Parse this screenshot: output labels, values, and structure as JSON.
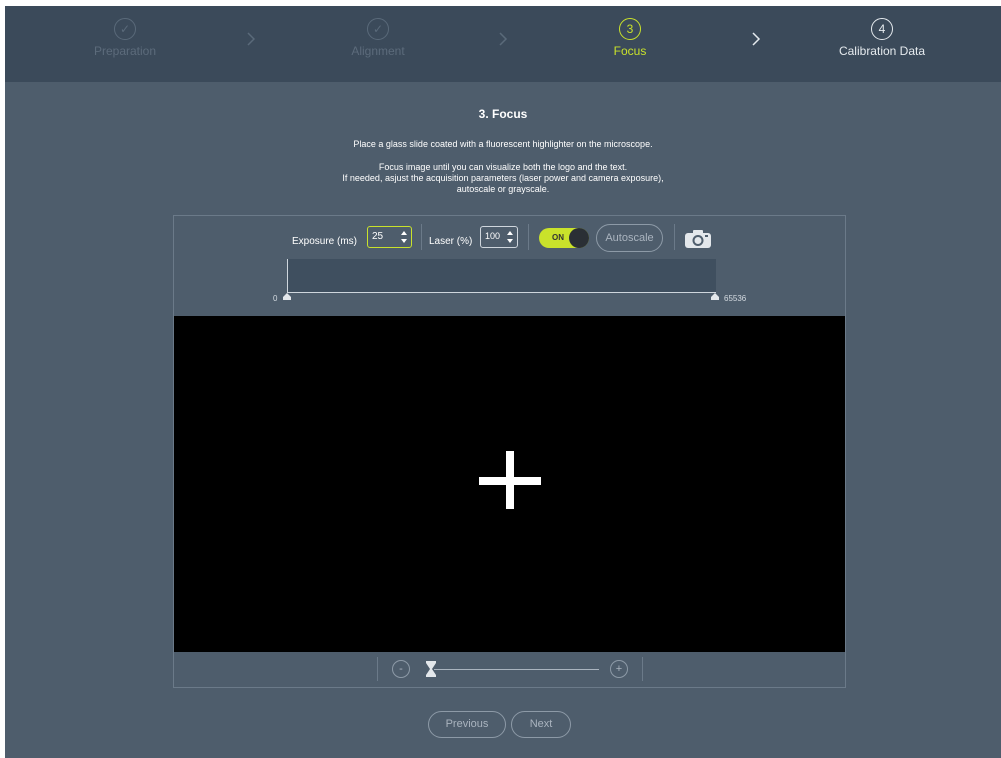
{
  "stepper": {
    "steps": [
      {
        "label": "Preparation",
        "marker": "✓",
        "state": "done"
      },
      {
        "label": "Alignment",
        "marker": "✓",
        "state": "done"
      },
      {
        "label": "Focus",
        "marker": "3",
        "state": "active"
      },
      {
        "label": "Calibration Data",
        "marker": "4",
        "state": "future"
      }
    ]
  },
  "content": {
    "title": "3. Focus",
    "line1": "Place a glass slide coated with a fluorescent highlighter on the microscope.",
    "line2": "Focus image until you can visualize both the logo and the text.",
    "line3": "If needed, asjust the acquisition parameters (laser power and camera exposure),",
    "line4": "autoscale or grayscale."
  },
  "toolbar": {
    "exposure_label": "Exposure (ms)",
    "exposure_value": "25",
    "laser_label": "Laser (%)",
    "laser_value": "100",
    "toggle_label": "ON",
    "autoscale_label": "Autoscale"
  },
  "histogram": {
    "min_label": "0",
    "max_label": "65536"
  },
  "zoom": {
    "minus_label": "-",
    "plus_label": "+",
    "level": 0
  },
  "footer": {
    "previous_label": "Previous",
    "next_label": "Next"
  },
  "colors": {
    "background": "#4e5d6c",
    "header": "#3b4a5a",
    "accent": "#c9e22b",
    "viewer": "#000000"
  },
  "icons": {
    "step_done": "check-circle-icon",
    "step_sep": "chevron-right-icon",
    "spinner": "spinner-arrows-icon",
    "snapshot": "camera-icon",
    "zoom_thumb": "hourglass-thumb-icon",
    "histogram_marker": "triangle-marker-icon",
    "crosshair": "crosshair-plus-icon"
  }
}
